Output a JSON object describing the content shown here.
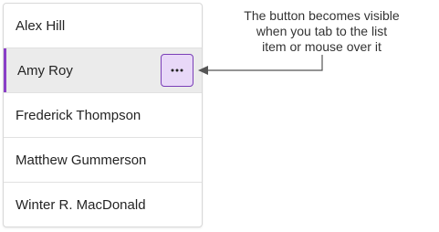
{
  "list": {
    "items": [
      {
        "label": "Alex Hill",
        "selected": false
      },
      {
        "label": "Amy Roy",
        "selected": true
      },
      {
        "label": "Frederick Thompson",
        "selected": false
      },
      {
        "label": "Matthew Gummerson",
        "selected": false
      },
      {
        "label": "Winter R. MacDonald",
        "selected": false
      }
    ],
    "more_button_icon": "more-horizontal-icon"
  },
  "callout": {
    "line1": "The button becomes visible",
    "line2": "when you tab to the list",
    "line3": "item or mouse over it"
  },
  "colors": {
    "accent": "#8a3fc7",
    "button_bg": "#e8d8f8",
    "button_border": "#7a3fb7",
    "selected_bg": "#ebebeb",
    "arrow": "#555555"
  }
}
